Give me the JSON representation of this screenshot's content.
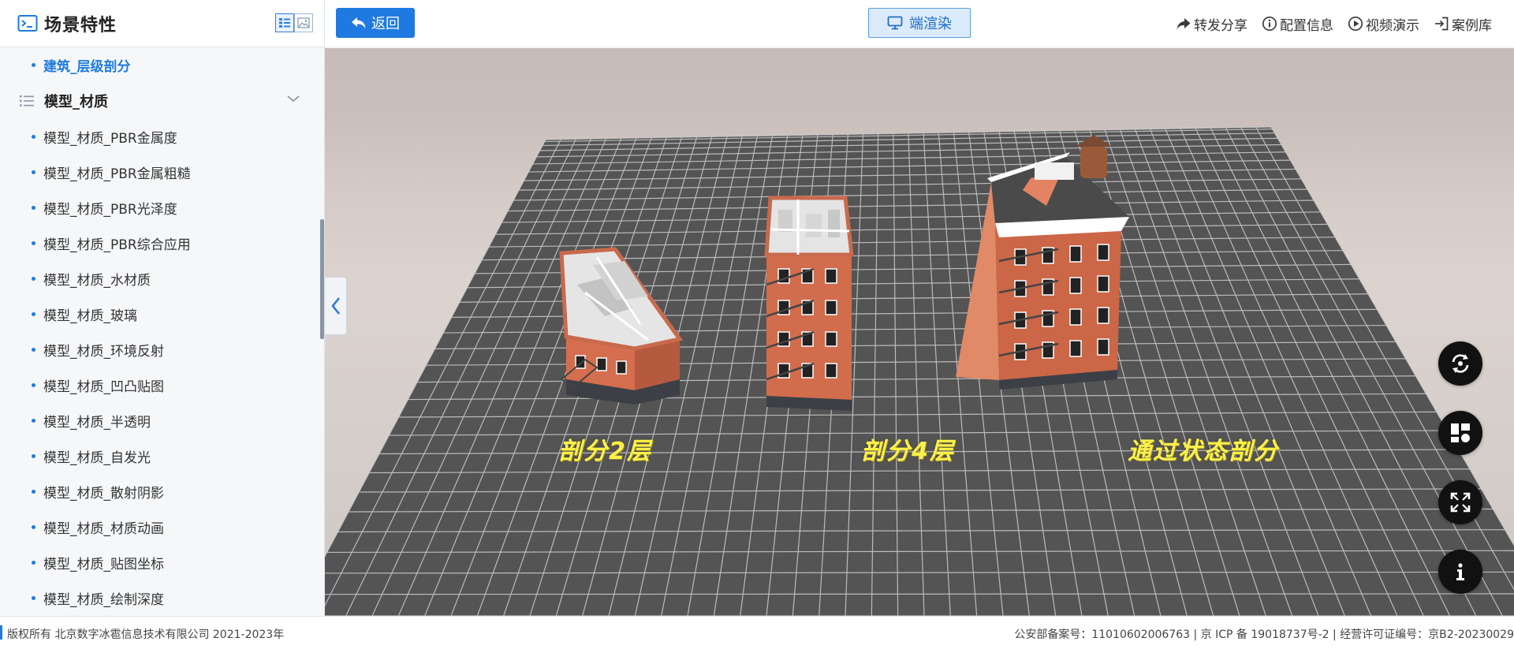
{
  "sidebar": {
    "title": "场景特性",
    "active_item": "建筑_层级剖分",
    "group_label": "模型_材质",
    "items": [
      "模型_材质_PBR金属度",
      "模型_材质_PBR金属粗糙",
      "模型_材质_PBR光泽度",
      "模型_材质_PBR综合应用",
      "模型_材质_水材质",
      "模型_材质_玻璃",
      "模型_材质_环境反射",
      "模型_材质_凹凸贴图",
      "模型_材质_半透明",
      "模型_材质_自发光",
      "模型_材质_散射阴影",
      "模型_材质_材质动画",
      "模型_材质_贴图坐标",
      "模型_材质_绘制深度"
    ]
  },
  "topbar": {
    "back_label": "返回",
    "render_label": "端渲染",
    "actions": {
      "share": "转发分享",
      "config": "配置信息",
      "video": "视频演示",
      "cases": "案例库"
    }
  },
  "scene": {
    "labels": [
      "剖分2层",
      "剖分4层",
      "通过状态剖分"
    ]
  },
  "footer": {
    "copyright": "版权所有 北京数字冰雹信息技术有限公司 2021-2023年",
    "icp": "公安部备案号：11010602006763 | 京 ICP 备 19018737号-2 | 经营许可证编号：京B2-20230029"
  },
  "colors": {
    "primary": "#1e7ae0",
    "label_yellow": "#fff04a",
    "brick": "#c9684a"
  }
}
